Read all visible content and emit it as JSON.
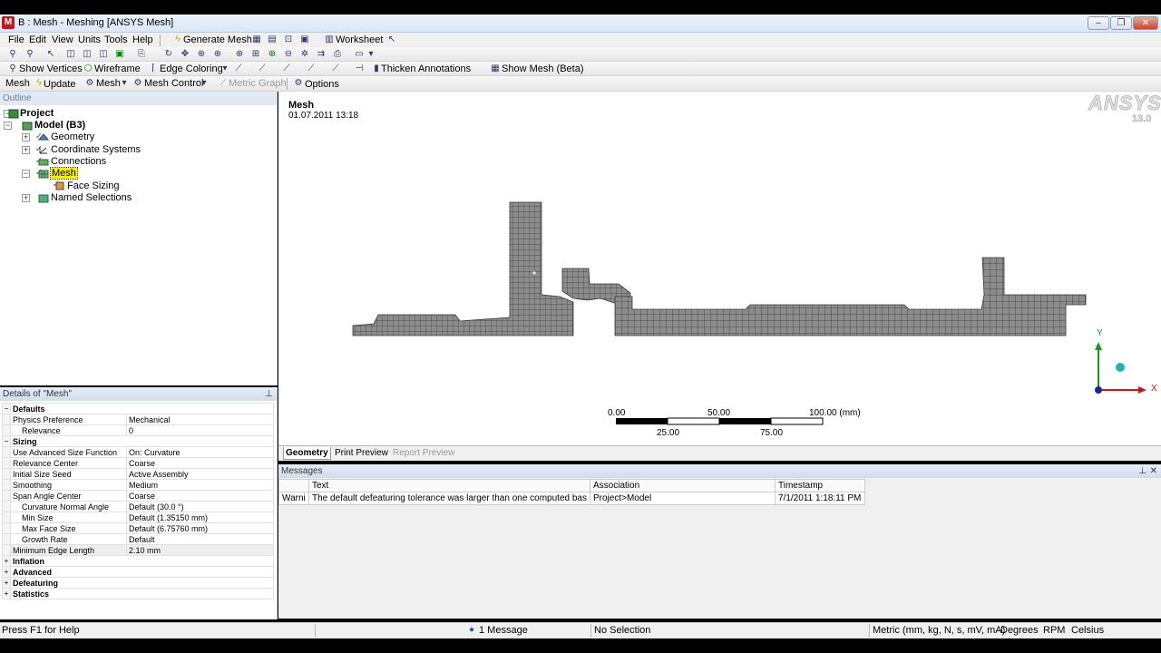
{
  "window": {
    "title": "B : Mesh - Meshing [ANSYS Mesh]",
    "app_icon": "M"
  },
  "menu": [
    "File",
    "Edit",
    "View",
    "Units",
    "Tools",
    "Help"
  ],
  "toolbar1": {
    "generate_mesh": "Generate Mesh",
    "worksheet": "Worksheet"
  },
  "toolbar3": {
    "show_vertices": "Show Vertices",
    "wireframe": "Wireframe",
    "edge_coloring": "Edge Coloring",
    "thicken_annotations": "Thicken Annotations",
    "show_mesh": "Show Mesh (Beta)"
  },
  "toolbar4": {
    "mesh_label": "Mesh",
    "update": "Update",
    "mesh_menu": "Mesh",
    "mesh_control": "Mesh Control",
    "metric_graph": "Metric Graph",
    "options": "Options"
  },
  "outline": {
    "title": "Outline",
    "items": [
      {
        "label": "Project"
      },
      {
        "label": "Model (B3)"
      },
      {
        "label": "Geometry"
      },
      {
        "label": "Coordinate Systems"
      },
      {
        "label": "Connections"
      },
      {
        "label": "Mesh"
      },
      {
        "label": "Face Sizing"
      },
      {
        "label": "Named Selections"
      }
    ]
  },
  "details": {
    "title": "Details of \"Mesh\"",
    "groups": {
      "defaults": "Defaults",
      "sizing": "Sizing",
      "inflation": "Inflation",
      "advanced": "Advanced",
      "defeaturing": "Defeaturing",
      "statistics": "Statistics"
    },
    "rows": [
      {
        "label": "Physics Preference",
        "value": "Mechanical"
      },
      {
        "label": "Relevance",
        "value": "0"
      },
      {
        "label": "Use Advanced Size Function",
        "value": "On: Curvature"
      },
      {
        "label": "Relevance Center",
        "value": "Coarse"
      },
      {
        "label": "Initial Size Seed",
        "value": "Active Assembly"
      },
      {
        "label": "Smoothing",
        "value": "Medium"
      },
      {
        "label": "Span Angle Center",
        "value": "Coarse"
      },
      {
        "label": "Curvature Normal Angle",
        "value": "Default (30.0 °)"
      },
      {
        "label": "Min Size",
        "value": "Default (1.35150 mm)"
      },
      {
        "label": "Max Face Size",
        "value": "Default (6.75760 mm)"
      },
      {
        "label": "Growth Rate",
        "value": "Default"
      },
      {
        "label": "Minimum Edge Length",
        "value": "2.10 mm"
      }
    ]
  },
  "viewport": {
    "title": "Mesh",
    "date": "01.07.2011 13:18",
    "logo": "ANSYS",
    "version": "13.0",
    "scale": {
      "labels_top": [
        "0.00",
        "50.00",
        "100.00 (mm)"
      ],
      "labels_bottom": [
        "25.00",
        "75.00"
      ]
    },
    "axis_x": "X",
    "axis_y": "Y"
  },
  "view_tabs": [
    "Geometry",
    "Print Preview",
    "Report Preview"
  ],
  "messages": {
    "title": "Messages",
    "columns": [
      "Text",
      "Association",
      "Timestamp"
    ],
    "rows": [
      {
        "type": "Warni",
        "text": "The default defeaturing tolerance was larger than one computed bas",
        "association": "Project>Model",
        "timestamp": "7/1/2011 1:18:11 PM"
      }
    ]
  },
  "status": {
    "help": "Press F1 for Help",
    "messages": "1 Message",
    "selection": "No Selection",
    "units": "Metric (mm, kg, N, s, mV, mA)",
    "angle": "Degrees",
    "rate": "RPM",
    "temp": "Celsius"
  },
  "colors": {
    "mesh_fill": "#8c8c8c",
    "mesh_line": "#3a3a3a",
    "selection": "#f7ee18"
  }
}
